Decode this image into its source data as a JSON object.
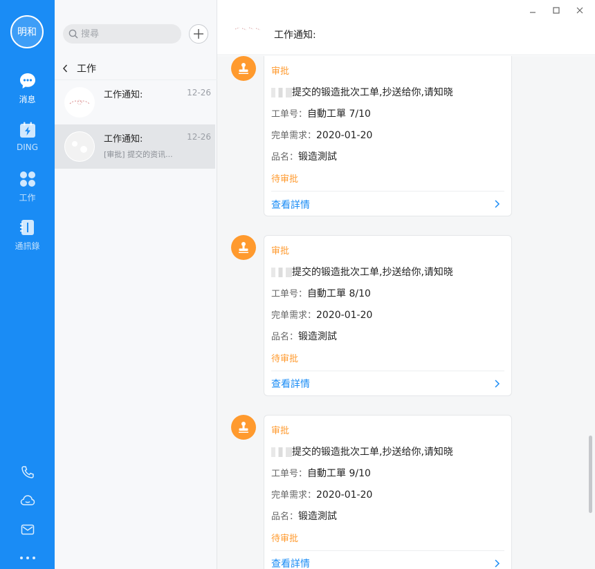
{
  "nav": {
    "avatar_text": "明和",
    "items": [
      {
        "label": "消息",
        "icon": "message-icon",
        "active": true
      },
      {
        "label": "DING",
        "icon": "ding-icon",
        "active": false
      },
      {
        "label": "工作",
        "icon": "work-icon",
        "active": false
      },
      {
        "label": "通訊錄",
        "icon": "contacts-icon",
        "active": false
      }
    ],
    "bottom_icons": [
      "phone-icon",
      "cloud-icon",
      "mail-icon",
      "more-icon"
    ]
  },
  "list": {
    "search_placeholder": "搜尋",
    "back_label": "工作",
    "conversations": [
      {
        "title": "工作通知:",
        "time": "12-26",
        "preview": "",
        "selected": false
      },
      {
        "title": "工作通知:",
        "time": "12-26",
        "preview": "[审批]  提交的资讯...",
        "selected": true
      }
    ]
  },
  "header": {
    "title": "工作通知:"
  },
  "messages": [
    {
      "type_label": "审批",
      "text": "提交的锻造批次工单,抄送给你,请知晓",
      "fields": [
        {
          "label": "工单号：",
          "value": "自動工單 7/10"
        },
        {
          "label": "完单需求：",
          "value": "2020-01-20"
        },
        {
          "label": "品名：",
          "value": "锻造測試"
        }
      ],
      "status": "待审批",
      "link": "查看詳情"
    },
    {
      "type_label": "审批",
      "text": "提交的锻造批次工单,抄送给你,请知晓",
      "fields": [
        {
          "label": "工单号：",
          "value": "自動工單 8/10"
        },
        {
          "label": "完单需求：",
          "value": "2020-01-20"
        },
        {
          "label": "品名：",
          "value": "锻造測試"
        }
      ],
      "status": "待审批",
      "link": "查看詳情"
    },
    {
      "type_label": "审批",
      "text": "提交的锻造批次工单,抄送给你,请知晓",
      "fields": [
        {
          "label": "工单号：",
          "value": "自動工單 9/10"
        },
        {
          "label": "完单需求：",
          "value": "2020-01-20"
        },
        {
          "label": "品名：",
          "value": "锻造測試"
        }
      ],
      "status": "待审批",
      "link": "查看詳情"
    }
  ],
  "colors": {
    "nav_bg": "#1a8cf5",
    "accent_orange": "#ff9a2e",
    "link_blue": "#1a8cf5"
  }
}
